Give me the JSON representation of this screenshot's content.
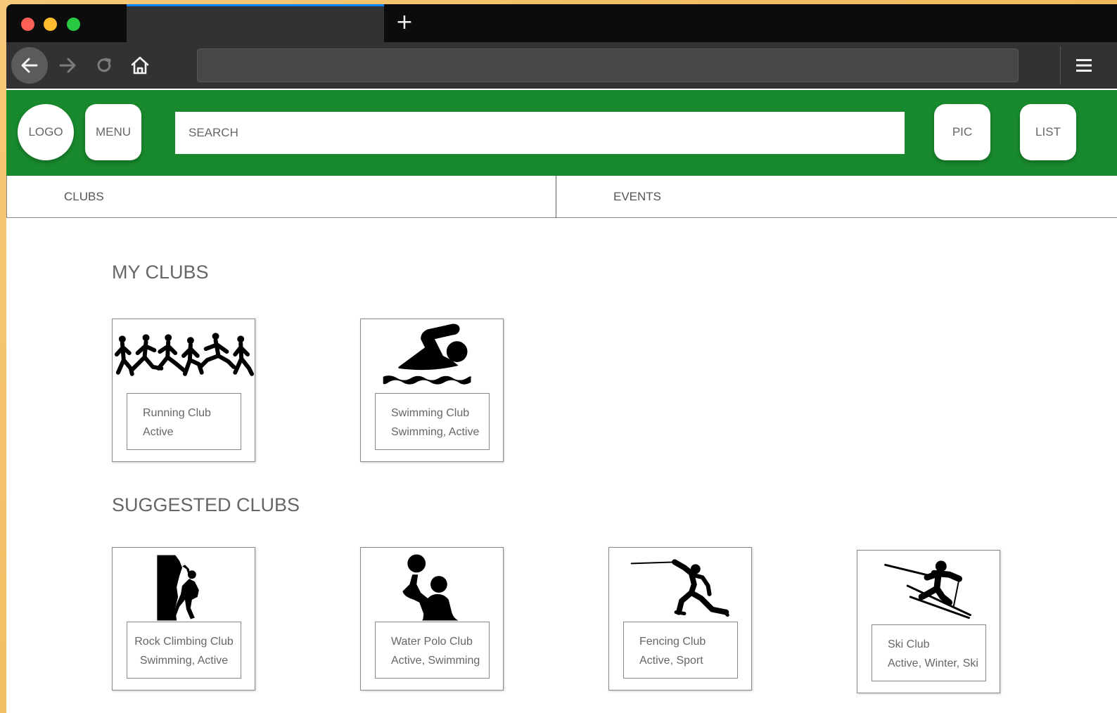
{
  "browser": {
    "new_tab_icon": "plus-icon",
    "url": ""
  },
  "header": {
    "logo_label": "LOGO",
    "menu_label": "MENU",
    "search_placeholder": "SEARCH",
    "pic_label": "PIC",
    "list_label": "LIST",
    "brand_color": "#18892d"
  },
  "nav": {
    "clubs_label": "CLUBS",
    "events_label": "EVENTS"
  },
  "my_clubs": {
    "title": "MY CLUBS",
    "items": [
      {
        "name": "Running Club",
        "tags": "Active",
        "icon": "running-icon"
      },
      {
        "name": "Swimming Club",
        "tags": "Swimming, Active",
        "icon": "swimming-icon"
      }
    ]
  },
  "suggested_clubs": {
    "title": "SUGGESTED CLUBS",
    "items": [
      {
        "name": "Rock Climbing Club",
        "tags": "Swimming, Active",
        "icon": "rock-climbing-icon"
      },
      {
        "name": "Water Polo Club",
        "tags": "Active, Swimming",
        "icon": "water-polo-icon"
      },
      {
        "name": "Fencing Club",
        "tags": "Active, Sport",
        "icon": "fencing-icon"
      },
      {
        "name": "Ski Club",
        "tags": "Active, Winter, Ski",
        "icon": "ski-icon"
      }
    ]
  }
}
